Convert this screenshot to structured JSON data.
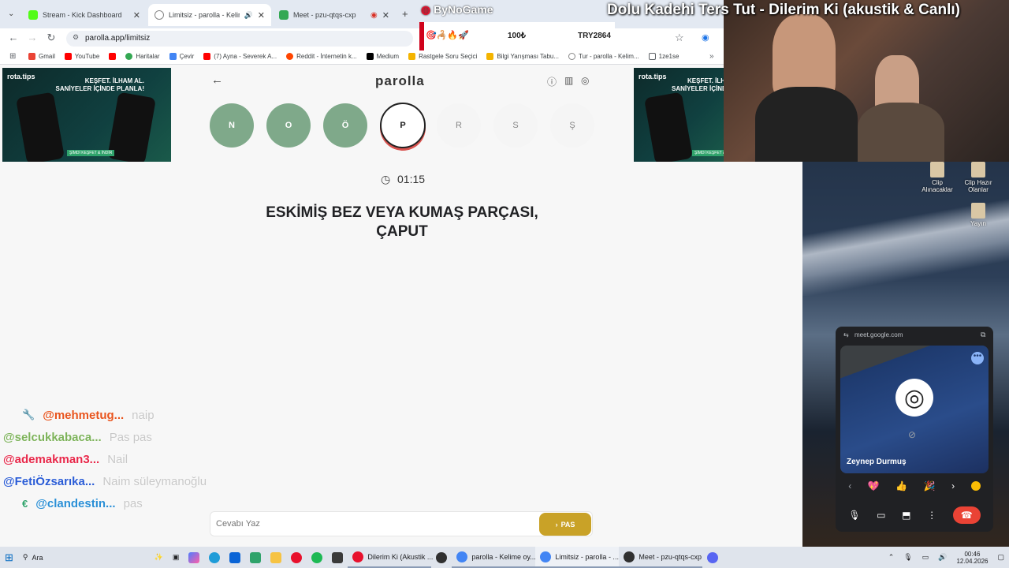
{
  "browser": {
    "tabs": [
      {
        "title": "Stream - Kick Dashboard",
        "color": "#53fc18",
        "active": false
      },
      {
        "title": "Limitsiz - parolla - Kelime o",
        "color": "#888888",
        "active": true
      },
      {
        "title": "Meet - pzu-qtqs-cxp",
        "color": "#34a853",
        "active": false
      }
    ],
    "new_tab": "+",
    "url": "parolla.app/limitsiz",
    "bookmarks": [
      {
        "label": "Gmail",
        "color": "#ea4335"
      },
      {
        "label": "YouTube",
        "color": "#ff0000"
      },
      {
        "label": "",
        "color": "#ff0000"
      },
      {
        "label": "Haritalar",
        "color": "#34a853"
      },
      {
        "label": "Çevir",
        "color": "#4285f4"
      },
      {
        "label": "(7) Ayna - Severek A...",
        "color": "#ff0000"
      },
      {
        "label": "Reddit - İnternetin k...",
        "color": "#ff4500"
      },
      {
        "label": "Medium",
        "color": "#000000"
      },
      {
        "label": "Rastgele Soru Seçici",
        "color": "#f4b400"
      },
      {
        "label": "Bilgi Yarışması Tabu...",
        "color": "#f4b400"
      },
      {
        "label": "Tur - parolla - Kelim...",
        "color": "#888888"
      },
      {
        "label": "1ze1se",
        "color": "#5f6368"
      }
    ]
  },
  "overlay": {
    "song_title": "Dolu Kadehi Ters Tut - Dilerim Ki (akustik & Canlı)",
    "sponsor": "ByNoGame",
    "donation_amount": "100₺",
    "donation_code": "TRY2864"
  },
  "game": {
    "title": "parolla",
    "letters": [
      {
        "char": "N",
        "state": "done"
      },
      {
        "char": "O",
        "state": "done"
      },
      {
        "char": "Ö",
        "state": "done"
      },
      {
        "char": "P",
        "state": "current"
      },
      {
        "char": "R",
        "state": "todo"
      },
      {
        "char": "S",
        "state": "todo"
      },
      {
        "char": "Ş",
        "state": "todo"
      }
    ],
    "timer": "01:15",
    "question_line1": "ESKİMİŞ BEZ VEYA KUMAŞ PARÇASI,",
    "question_line2": "ÇAPUT",
    "answer_placeholder": "Cevabı Yaz",
    "pass_label": "PAS"
  },
  "ads": {
    "brand": "rota.tips",
    "line1": "KEŞFET. İLHAM AL.",
    "line2": "SANİYELER İÇİNDE PLANLA!",
    "cta": "ŞİMDİ KEŞFET & İNDİR"
  },
  "chat": [
    {
      "user": "@mehmetug...",
      "msg": "naip",
      "color": "#e8541d",
      "badge": "🔧"
    },
    {
      "user": "@selcukkabaca...",
      "msg": "Pas pas",
      "color": "#7db35a",
      "badge": ""
    },
    {
      "user": "@ademakman3...",
      "msg": "Nail",
      "color": "#e8284a",
      "badge": ""
    },
    {
      "user": "@FetiÖzsarıka...",
      "msg": "Naim süleymanoğlu",
      "color": "#2a5cd6",
      "badge": ""
    },
    {
      "user": "@clandestin...",
      "msg": "pas",
      "color": "#2a8fd6",
      "badge": "€"
    }
  ],
  "desktop": {
    "icons": [
      "Clip Alınacaklar",
      "Clip Hazır Olanlar",
      "Yayın"
    ]
  },
  "meet": {
    "url": "meet.google.com",
    "participant": "Zeynep Durmuş"
  },
  "taskbar": {
    "search": "Ara",
    "apps": [
      {
        "label": "Dilerim Ki (Akustik ...",
        "color": "#e8112d"
      },
      {
        "label": "parolla - Kelime oy...",
        "color": "#4285f4"
      },
      {
        "label": "Limitsiz - parolla - ...",
        "color": "#4285f4"
      },
      {
        "label": "Meet - pzu-qtqs-cxp",
        "color": "#303030"
      }
    ],
    "time": "00:46",
    "date": "12.04.2026"
  }
}
